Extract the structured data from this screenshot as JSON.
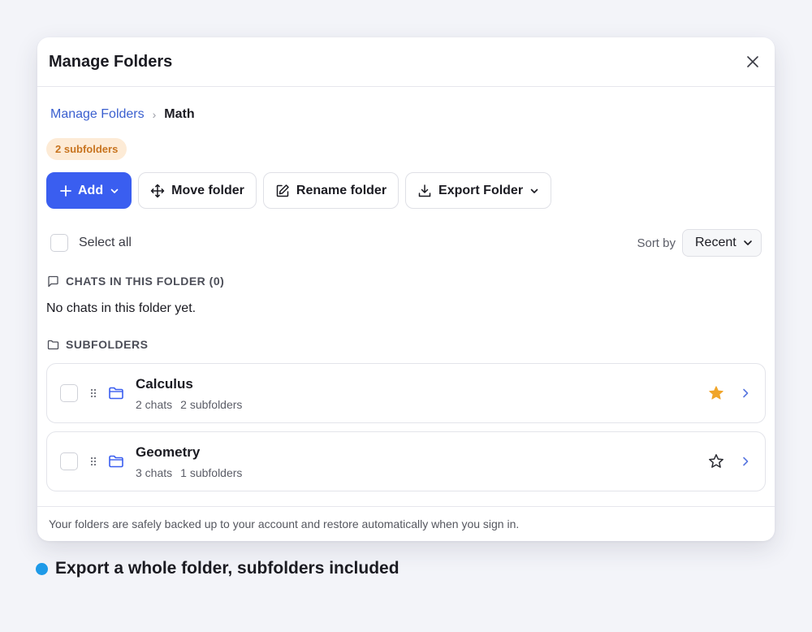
{
  "modal": {
    "title": "Manage Folders"
  },
  "breadcrumb": {
    "root": "Manage Folders",
    "separator": "›",
    "current": "Math"
  },
  "badge": {
    "label": "2 subfolders"
  },
  "toolbar": {
    "add_label": "Add",
    "move_label": "Move folder",
    "rename_label": "Rename folder",
    "export_label": "Export Folder"
  },
  "selection": {
    "select_all_label": "Select all",
    "sort_label": "Sort by",
    "sort_value": "Recent"
  },
  "chats_section": {
    "heading": "CHATS IN THIS FOLDER (0)",
    "empty_text": "No chats in this folder yet."
  },
  "subfolders_section": {
    "heading": "SUBFOLDERS",
    "items": [
      {
        "name": "Calculus",
        "chats": "2 chats",
        "subfolders": "2 subfolders",
        "starred": true
      },
      {
        "name": "Geometry",
        "chats": "3 chats",
        "subfolders": "1 subfolders",
        "starred": false
      }
    ]
  },
  "footer": {
    "text": "Your folders are safely backed up to your account and restore automatically when you sign in."
  },
  "caption": {
    "text": "Export a whole folder, subfolders included"
  },
  "colors": {
    "accent": "#3a5ef0",
    "link": "#3a5fcf",
    "star": "#f0a52a",
    "caption_dot": "#1e9ae8",
    "badge_bg": "#fdebd6",
    "badge_text": "#c8741f"
  }
}
